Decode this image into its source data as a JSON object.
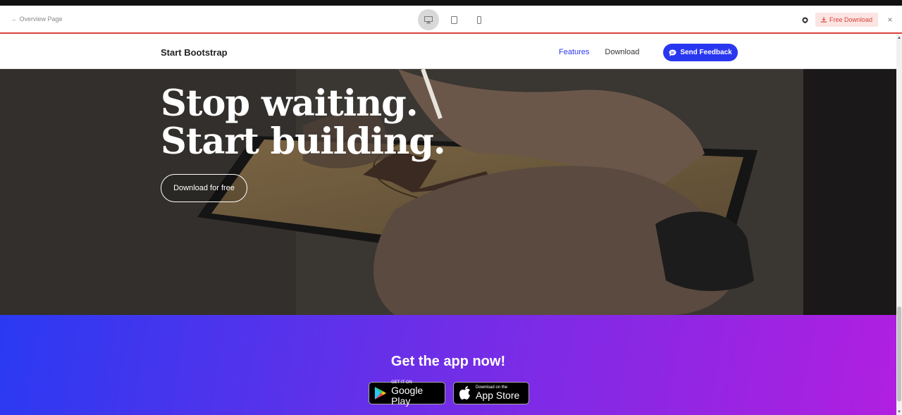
{
  "preview_toolbar": {
    "back_label": "← Overview Page",
    "free_download_label": "Free Download",
    "close_label": "×"
  },
  "site_nav": {
    "brand": "Start Bootstrap",
    "links": [
      {
        "label": "Features",
        "active": true
      },
      {
        "label": "Download",
        "active": false
      }
    ],
    "feedback_label": "Send Feedback"
  },
  "hero": {
    "title_line1": "Stop waiting.",
    "title_line2": "Start building.",
    "button_label": "Download for free"
  },
  "cta": {
    "title": "Get the app now!",
    "google_play": {
      "small": "GET IT ON",
      "big": "Google Play"
    },
    "app_store": {
      "small": "Download on the",
      "big": "App Store"
    }
  },
  "colors": {
    "accent_blue": "#2937f0",
    "toolbar_red": "#d9423a",
    "gradient_start": "#2a3af2",
    "gradient_end": "#b11fe0"
  }
}
